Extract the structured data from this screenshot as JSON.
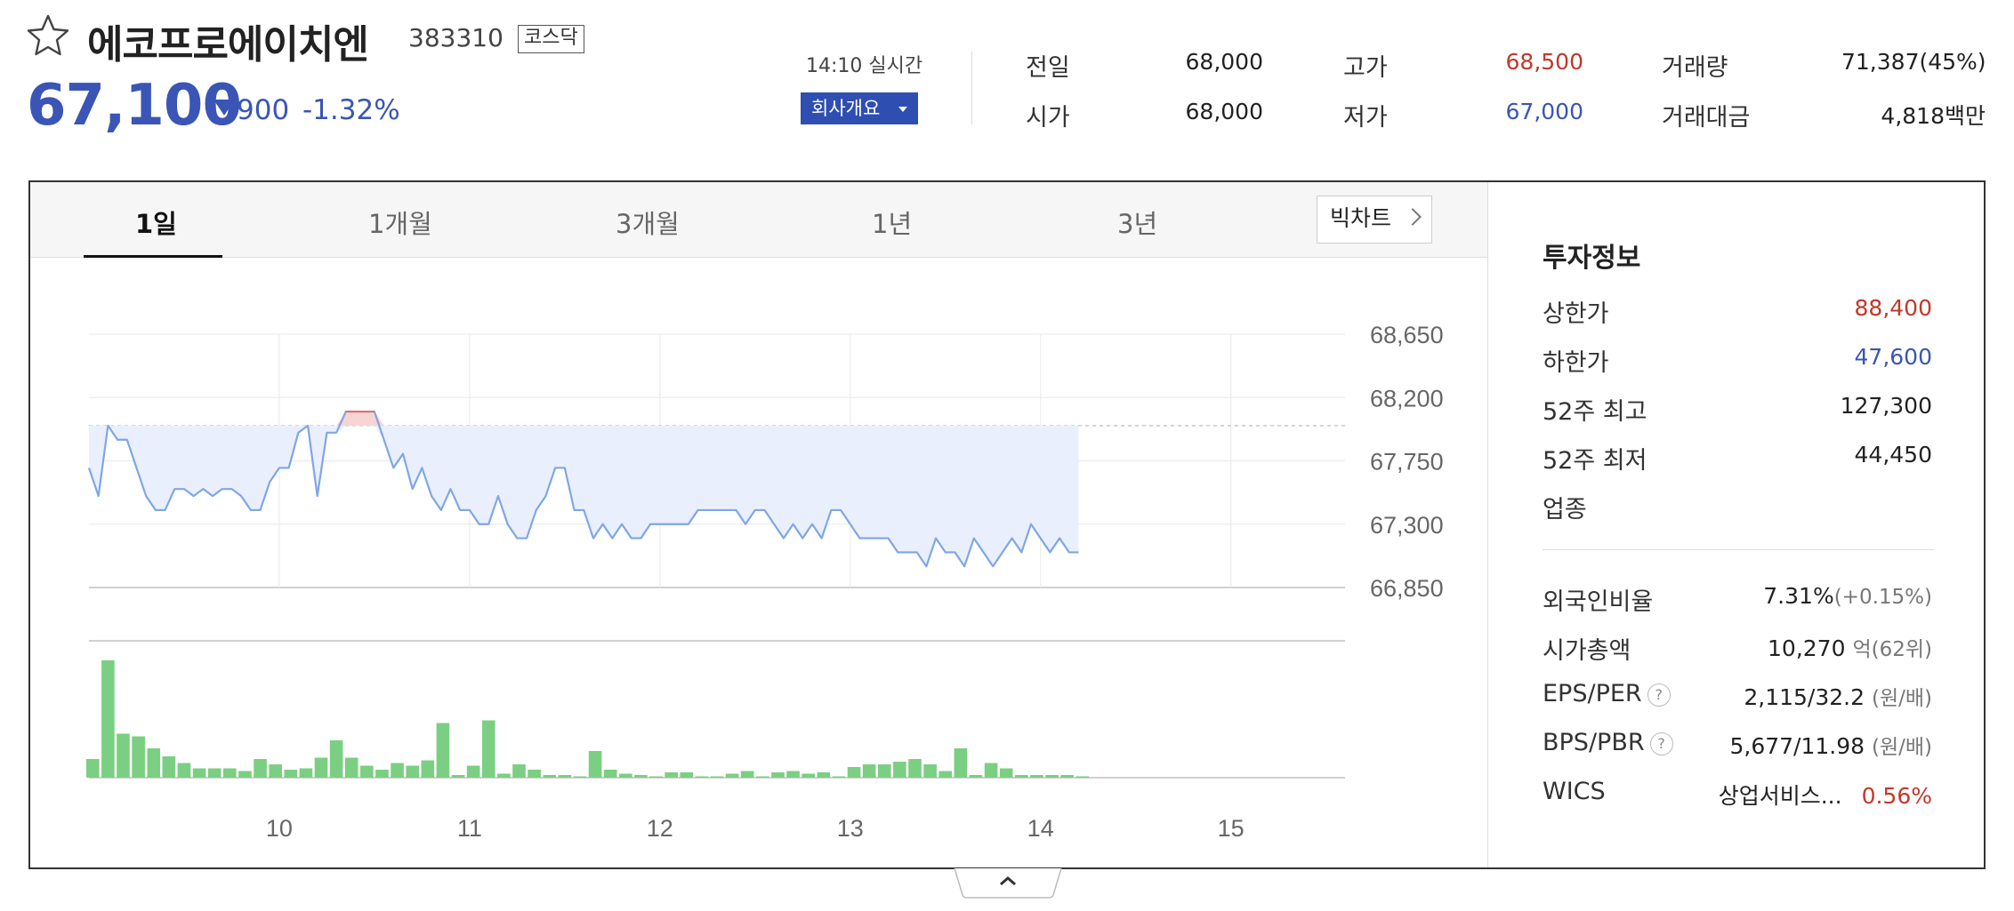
{
  "header": {
    "name": "에코프로에이치엔",
    "code": "383310",
    "market": "코스닥",
    "price": "67,100",
    "change_amount": "900",
    "change_percent": "-1.32%",
    "realtime": "14:10 실시간",
    "company_button": "회사개요"
  },
  "stats": {
    "prev_close": {
      "label": "전일",
      "value": "68,000"
    },
    "open": {
      "label": "시가",
      "value": "68,000"
    },
    "high": {
      "label": "고가",
      "value": "68,500"
    },
    "low": {
      "label": "저가",
      "value": "67,000"
    },
    "volume": {
      "label": "거래량",
      "value": "71,387(45%)"
    },
    "trade_value": {
      "label": "거래대금",
      "value": "4,818백만"
    }
  },
  "tabs": [
    "1일",
    "1개월",
    "3개월",
    "1년",
    "3년"
  ],
  "bigchart_label": "빅차트",
  "invest": {
    "title": "투자정보",
    "rows": [
      {
        "label": "상한가",
        "value": "88,400"
      },
      {
        "label": "하한가",
        "value": "47,600"
      },
      {
        "label": "52주 최고",
        "value": "127,300"
      },
      {
        "label": "52주 최저",
        "value": "44,450"
      },
      {
        "label": "업종",
        "value": ""
      }
    ],
    "rows2": [
      {
        "label": "외국인비율",
        "value": "7.31%",
        "sub": "(+0.15%)"
      },
      {
        "label": "시가총액",
        "value": "10,270",
        "sub": "억(62위)"
      },
      {
        "label": "EPS/PER",
        "value": "2,115/32.2",
        "sub": "(원/배)",
        "help": "?"
      },
      {
        "label": "BPS/PBR",
        "value": "5,677/11.98",
        "sub": "(원/배)",
        "help": "?"
      },
      {
        "label": "WICS",
        "value": "상업서비스...",
        "sub": "0.56%"
      }
    ]
  },
  "colors": {
    "up": "#c0392b",
    "down": "#3a55b5",
    "line": "#7fa6e8",
    "fill": "#e9effc",
    "volume": "#7bcf82"
  },
  "chart_data": {
    "type": "line",
    "y_ticks": [
      "68,650",
      "68,200",
      "67,750",
      "67,300",
      "66,850"
    ],
    "x_ticks": [
      "10",
      "11",
      "12",
      "13",
      "14",
      "15"
    ],
    "prev_close": 68000,
    "ylim": [
      66850,
      68650
    ],
    "price": [
      [
        9.0,
        67700
      ],
      [
        9.05,
        67500
      ],
      [
        9.1,
        68000
      ],
      [
        9.15,
        67900
      ],
      [
        9.2,
        67900
      ],
      [
        9.25,
        67700
      ],
      [
        9.3,
        67500
      ],
      [
        9.35,
        67400
      ],
      [
        9.4,
        67400
      ],
      [
        9.45,
        67550
      ],
      [
        9.5,
        67550
      ],
      [
        9.55,
        67500
      ],
      [
        9.6,
        67550
      ],
      [
        9.65,
        67500
      ],
      [
        9.7,
        67550
      ],
      [
        9.75,
        67550
      ],
      [
        9.8,
        67500
      ],
      [
        9.85,
        67400
      ],
      [
        9.9,
        67400
      ],
      [
        9.95,
        67600
      ],
      [
        10.0,
        67700
      ],
      [
        10.05,
        67700
      ],
      [
        10.1,
        67950
      ],
      [
        10.15,
        68000
      ],
      [
        10.2,
        67500
      ],
      [
        10.25,
        67950
      ],
      [
        10.3,
        67950
      ],
      [
        10.35,
        68100
      ],
      [
        10.4,
        68100
      ],
      [
        10.45,
        68100
      ],
      [
        10.5,
        68100
      ],
      [
        10.55,
        67900
      ],
      [
        10.6,
        67700
      ],
      [
        10.65,
        67800
      ],
      [
        10.7,
        67550
      ],
      [
        10.75,
        67700
      ],
      [
        10.8,
        67500
      ],
      [
        10.85,
        67400
      ],
      [
        10.9,
        67550
      ],
      [
        10.95,
        67400
      ],
      [
        11.0,
        67400
      ],
      [
        11.05,
        67300
      ],
      [
        11.1,
        67300
      ],
      [
        11.15,
        67500
      ],
      [
        11.2,
        67300
      ],
      [
        11.25,
        67200
      ],
      [
        11.3,
        67200
      ],
      [
        11.35,
        67400
      ],
      [
        11.4,
        67500
      ],
      [
        11.45,
        67700
      ],
      [
        11.5,
        67700
      ],
      [
        11.55,
        67400
      ],
      [
        11.6,
        67400
      ],
      [
        11.65,
        67200
      ],
      [
        11.7,
        67300
      ],
      [
        11.75,
        67200
      ],
      [
        11.8,
        67300
      ],
      [
        11.85,
        67200
      ],
      [
        11.9,
        67200
      ],
      [
        11.95,
        67300
      ],
      [
        12.0,
        67300
      ],
      [
        12.05,
        67300
      ],
      [
        12.1,
        67300
      ],
      [
        12.15,
        67300
      ],
      [
        12.2,
        67400
      ],
      [
        12.25,
        67400
      ],
      [
        12.3,
        67400
      ],
      [
        12.35,
        67400
      ],
      [
        12.4,
        67400
      ],
      [
        12.45,
        67300
      ],
      [
        12.5,
        67400
      ],
      [
        12.55,
        67400
      ],
      [
        12.6,
        67300
      ],
      [
        12.65,
        67200
      ],
      [
        12.7,
        67300
      ],
      [
        12.75,
        67200
      ],
      [
        12.8,
        67300
      ],
      [
        12.85,
        67200
      ],
      [
        12.9,
        67400
      ],
      [
        12.95,
        67400
      ],
      [
        13.0,
        67300
      ],
      [
        13.05,
        67200
      ],
      [
        13.1,
        67200
      ],
      [
        13.15,
        67200
      ],
      [
        13.2,
        67200
      ],
      [
        13.25,
        67100
      ],
      [
        13.3,
        67100
      ],
      [
        13.35,
        67100
      ],
      [
        13.4,
        67000
      ],
      [
        13.45,
        67200
      ],
      [
        13.5,
        67100
      ],
      [
        13.55,
        67100
      ],
      [
        13.6,
        67000
      ],
      [
        13.65,
        67200
      ],
      [
        13.7,
        67100
      ],
      [
        13.75,
        67000
      ],
      [
        13.8,
        67100
      ],
      [
        13.85,
        67200
      ],
      [
        13.9,
        67100
      ],
      [
        13.95,
        67300
      ],
      [
        14.0,
        67200
      ],
      [
        14.05,
        67100
      ],
      [
        14.1,
        67200
      ],
      [
        14.15,
        67100
      ],
      [
        14.2,
        67100
      ]
    ],
    "volume": [
      [
        9.02,
        14
      ],
      [
        9.1,
        88
      ],
      [
        9.18,
        33
      ],
      [
        9.26,
        31
      ],
      [
        9.34,
        22
      ],
      [
        9.42,
        16
      ],
      [
        9.5,
        11
      ],
      [
        9.58,
        7
      ],
      [
        9.66,
        7
      ],
      [
        9.74,
        7
      ],
      [
        9.82,
        5
      ],
      [
        9.9,
        14
      ],
      [
        9.98,
        10
      ],
      [
        10.06,
        6
      ],
      [
        10.14,
        7
      ],
      [
        10.22,
        15
      ],
      [
        10.3,
        28
      ],
      [
        10.38,
        15
      ],
      [
        10.46,
        9
      ],
      [
        10.54,
        6
      ],
      [
        10.62,
        11
      ],
      [
        10.7,
        9
      ],
      [
        10.78,
        13
      ],
      [
        10.86,
        41
      ],
      [
        10.94,
        2
      ],
      [
        11.02,
        9
      ],
      [
        11.1,
        43
      ],
      [
        11.18,
        3
      ],
      [
        11.26,
        10
      ],
      [
        11.34,
        6
      ],
      [
        11.42,
        2
      ],
      [
        11.5,
        2
      ],
      [
        11.58,
        1
      ],
      [
        11.66,
        20
      ],
      [
        11.74,
        6
      ],
      [
        11.82,
        3
      ],
      [
        11.9,
        2
      ],
      [
        11.98,
        1
      ],
      [
        12.06,
        4
      ],
      [
        12.14,
        4
      ],
      [
        12.22,
        1
      ],
      [
        12.3,
        1
      ],
      [
        12.38,
        3
      ],
      [
        12.46,
        5
      ],
      [
        12.54,
        1
      ],
      [
        12.62,
        4
      ],
      [
        12.7,
        5
      ],
      [
        12.78,
        3
      ],
      [
        12.86,
        4
      ],
      [
        12.94,
        1
      ],
      [
        13.02,
        8
      ],
      [
        13.1,
        10
      ],
      [
        13.18,
        10
      ],
      [
        13.26,
        12
      ],
      [
        13.34,
        14
      ],
      [
        13.42,
        10
      ],
      [
        13.5,
        5
      ],
      [
        13.58,
        22
      ],
      [
        13.66,
        2
      ],
      [
        13.74,
        11
      ],
      [
        13.82,
        7
      ],
      [
        13.9,
        2
      ],
      [
        13.98,
        2
      ],
      [
        14.06,
        2
      ],
      [
        14.14,
        2
      ],
      [
        14.22,
        1
      ]
    ]
  }
}
